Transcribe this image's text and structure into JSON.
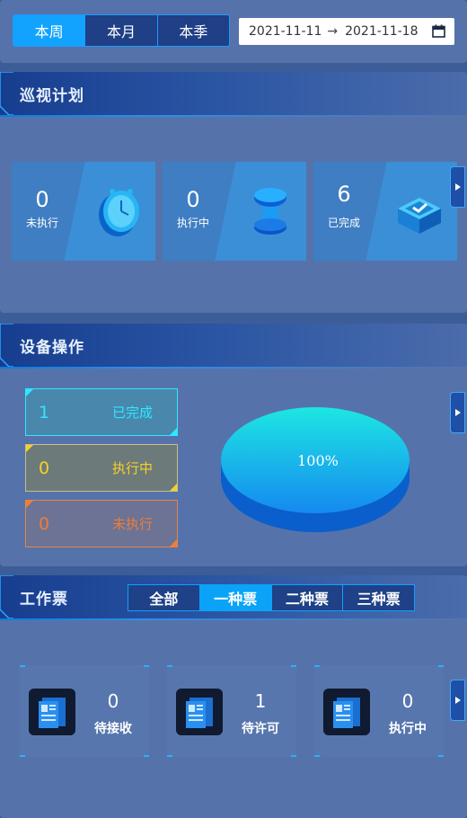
{
  "top": {
    "tabs": [
      {
        "label": "本周",
        "active": true
      },
      {
        "label": "本月",
        "active": false
      },
      {
        "label": "本季",
        "active": false
      }
    ],
    "date_range": {
      "start": "2021-11-11",
      "separator": "→",
      "end": "2021-11-18"
    }
  },
  "patrol": {
    "title": "巡视计划",
    "cards": [
      {
        "value": "0",
        "label": "未执行",
        "icon": "clock-icon"
      },
      {
        "value": "0",
        "label": "执行中",
        "icon": "hourglass-icon"
      },
      {
        "value": "6",
        "label": "已完成",
        "icon": "checkbox-icon"
      }
    ]
  },
  "device": {
    "title": "设备操作",
    "statuses": [
      {
        "value": "1",
        "label": "已完成",
        "color": "#2ee8ff"
      },
      {
        "value": "0",
        "label": "执行中",
        "color": "#f5d02c"
      },
      {
        "value": "0",
        "label": "未执行",
        "color": "#f07c37"
      }
    ],
    "pie_label": "100%"
  },
  "ticket": {
    "title": "工作票",
    "tabs": [
      {
        "label": "全部",
        "active": false
      },
      {
        "label": "一种票",
        "active": true
      },
      {
        "label": "二种票",
        "active": false
      },
      {
        "label": "三种票",
        "active": false
      }
    ],
    "cards": [
      {
        "value": "0",
        "label": "待接收",
        "icon": "document-icon"
      },
      {
        "value": "1",
        "label": "待许可",
        "icon": "document-icon"
      },
      {
        "value": "0",
        "label": "执行中",
        "icon": "document-icon"
      }
    ]
  },
  "colors": {
    "accent": "#12a3ff",
    "panel": "#5573aa",
    "header": "#173d8f"
  }
}
